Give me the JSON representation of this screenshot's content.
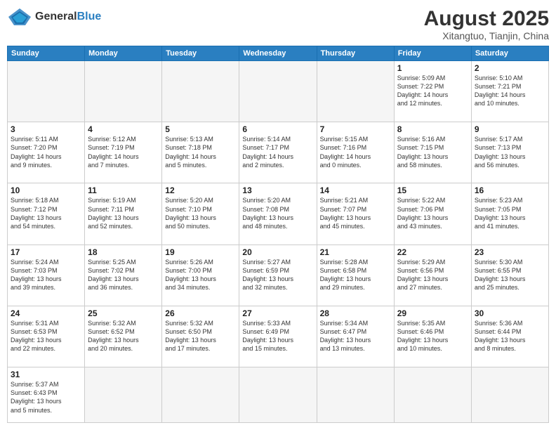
{
  "header": {
    "logo_general": "General",
    "logo_blue": "Blue",
    "month_title": "August 2025",
    "location": "Xitangtuo, Tianjin, China"
  },
  "weekdays": [
    "Sunday",
    "Monday",
    "Tuesday",
    "Wednesday",
    "Thursday",
    "Friday",
    "Saturday"
  ],
  "weeks": [
    [
      {
        "day": "",
        "info": ""
      },
      {
        "day": "",
        "info": ""
      },
      {
        "day": "",
        "info": ""
      },
      {
        "day": "",
        "info": ""
      },
      {
        "day": "",
        "info": ""
      },
      {
        "day": "1",
        "info": "Sunrise: 5:09 AM\nSunset: 7:22 PM\nDaylight: 14 hours\nand 12 minutes."
      },
      {
        "day": "2",
        "info": "Sunrise: 5:10 AM\nSunset: 7:21 PM\nDaylight: 14 hours\nand 10 minutes."
      }
    ],
    [
      {
        "day": "3",
        "info": "Sunrise: 5:11 AM\nSunset: 7:20 PM\nDaylight: 14 hours\nand 9 minutes."
      },
      {
        "day": "4",
        "info": "Sunrise: 5:12 AM\nSunset: 7:19 PM\nDaylight: 14 hours\nand 7 minutes."
      },
      {
        "day": "5",
        "info": "Sunrise: 5:13 AM\nSunset: 7:18 PM\nDaylight: 14 hours\nand 5 minutes."
      },
      {
        "day": "6",
        "info": "Sunrise: 5:14 AM\nSunset: 7:17 PM\nDaylight: 14 hours\nand 2 minutes."
      },
      {
        "day": "7",
        "info": "Sunrise: 5:15 AM\nSunset: 7:16 PM\nDaylight: 14 hours\nand 0 minutes."
      },
      {
        "day": "8",
        "info": "Sunrise: 5:16 AM\nSunset: 7:15 PM\nDaylight: 13 hours\nand 58 minutes."
      },
      {
        "day": "9",
        "info": "Sunrise: 5:17 AM\nSunset: 7:13 PM\nDaylight: 13 hours\nand 56 minutes."
      }
    ],
    [
      {
        "day": "10",
        "info": "Sunrise: 5:18 AM\nSunset: 7:12 PM\nDaylight: 13 hours\nand 54 minutes."
      },
      {
        "day": "11",
        "info": "Sunrise: 5:19 AM\nSunset: 7:11 PM\nDaylight: 13 hours\nand 52 minutes."
      },
      {
        "day": "12",
        "info": "Sunrise: 5:20 AM\nSunset: 7:10 PM\nDaylight: 13 hours\nand 50 minutes."
      },
      {
        "day": "13",
        "info": "Sunrise: 5:20 AM\nSunset: 7:08 PM\nDaylight: 13 hours\nand 48 minutes."
      },
      {
        "day": "14",
        "info": "Sunrise: 5:21 AM\nSunset: 7:07 PM\nDaylight: 13 hours\nand 45 minutes."
      },
      {
        "day": "15",
        "info": "Sunrise: 5:22 AM\nSunset: 7:06 PM\nDaylight: 13 hours\nand 43 minutes."
      },
      {
        "day": "16",
        "info": "Sunrise: 5:23 AM\nSunset: 7:05 PM\nDaylight: 13 hours\nand 41 minutes."
      }
    ],
    [
      {
        "day": "17",
        "info": "Sunrise: 5:24 AM\nSunset: 7:03 PM\nDaylight: 13 hours\nand 39 minutes."
      },
      {
        "day": "18",
        "info": "Sunrise: 5:25 AM\nSunset: 7:02 PM\nDaylight: 13 hours\nand 36 minutes."
      },
      {
        "day": "19",
        "info": "Sunrise: 5:26 AM\nSunset: 7:00 PM\nDaylight: 13 hours\nand 34 minutes."
      },
      {
        "day": "20",
        "info": "Sunrise: 5:27 AM\nSunset: 6:59 PM\nDaylight: 13 hours\nand 32 minutes."
      },
      {
        "day": "21",
        "info": "Sunrise: 5:28 AM\nSunset: 6:58 PM\nDaylight: 13 hours\nand 29 minutes."
      },
      {
        "day": "22",
        "info": "Sunrise: 5:29 AM\nSunset: 6:56 PM\nDaylight: 13 hours\nand 27 minutes."
      },
      {
        "day": "23",
        "info": "Sunrise: 5:30 AM\nSunset: 6:55 PM\nDaylight: 13 hours\nand 25 minutes."
      }
    ],
    [
      {
        "day": "24",
        "info": "Sunrise: 5:31 AM\nSunset: 6:53 PM\nDaylight: 13 hours\nand 22 minutes."
      },
      {
        "day": "25",
        "info": "Sunrise: 5:32 AM\nSunset: 6:52 PM\nDaylight: 13 hours\nand 20 minutes."
      },
      {
        "day": "26",
        "info": "Sunrise: 5:32 AM\nSunset: 6:50 PM\nDaylight: 13 hours\nand 17 minutes."
      },
      {
        "day": "27",
        "info": "Sunrise: 5:33 AM\nSunset: 6:49 PM\nDaylight: 13 hours\nand 15 minutes."
      },
      {
        "day": "28",
        "info": "Sunrise: 5:34 AM\nSunset: 6:47 PM\nDaylight: 13 hours\nand 13 minutes."
      },
      {
        "day": "29",
        "info": "Sunrise: 5:35 AM\nSunset: 6:46 PM\nDaylight: 13 hours\nand 10 minutes."
      },
      {
        "day": "30",
        "info": "Sunrise: 5:36 AM\nSunset: 6:44 PM\nDaylight: 13 hours\nand 8 minutes."
      }
    ],
    [
      {
        "day": "31",
        "info": "Sunrise: 5:37 AM\nSunset: 6:43 PM\nDaylight: 13 hours\nand 5 minutes."
      },
      {
        "day": "",
        "info": ""
      },
      {
        "day": "",
        "info": ""
      },
      {
        "day": "",
        "info": ""
      },
      {
        "day": "",
        "info": ""
      },
      {
        "day": "",
        "info": ""
      },
      {
        "day": "",
        "info": ""
      }
    ]
  ]
}
